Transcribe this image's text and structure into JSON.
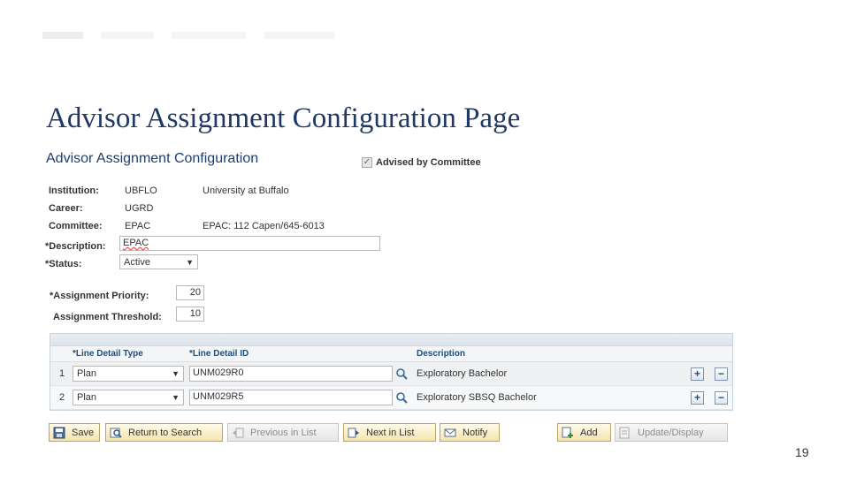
{
  "slide": {
    "title": "Advisor Assignment Configuration Page",
    "page_number": "19"
  },
  "panel": {
    "title": "Advisor Assignment Configuration",
    "advised_by_committee": {
      "label": "Advised by Committee",
      "checked": true
    },
    "fields": {
      "institution": {
        "label": "Institution:",
        "code": "UBFLO",
        "description": "University at Buffalo"
      },
      "career": {
        "label": "Career:",
        "code": "UGRD"
      },
      "committee": {
        "label": "Committee:",
        "code": "EPAC",
        "description": "EPAC: 112 Capen/645-6013"
      },
      "description": {
        "label": "*Description:",
        "value": "EPAC"
      },
      "status": {
        "label": "*Status:",
        "value": "Active"
      },
      "assignment_priority": {
        "label": "*Assignment Priority:",
        "value": "20"
      },
      "assignment_threshold": {
        "label": "Assignment Threshold:",
        "value": "10"
      }
    }
  },
  "grid": {
    "columns": [
      "*Line Detail Type",
      "*Line Detail ID",
      "Description"
    ],
    "rows": [
      {
        "num": "1",
        "type": "Plan",
        "id": "UNM029R0",
        "description": "Exploratory Bachelor"
      },
      {
        "num": "2",
        "type": "Plan",
        "id": "UNM029R5",
        "description": "Exploratory SBSQ Bachelor"
      }
    ],
    "add_row_symbol": "+",
    "delete_row_symbol": "−"
  },
  "toolbar": {
    "save": "Save",
    "return_to_search": "Return to Search",
    "previous_in_list": "Previous in List",
    "next_in_list": "Next in List",
    "notify": "Notify",
    "add": "Add",
    "update_display": "Update/Display"
  },
  "icons": {
    "checkbox": "checkbox-checked-icon",
    "lookup": "magnifier-icon",
    "save": "floppy-disk-icon",
    "return": "search-return-icon",
    "previous": "previous-list-icon",
    "next": "next-list-icon",
    "notify": "notify-envelope-icon",
    "add": "add-page-icon",
    "update": "update-display-icon"
  },
  "colors": {
    "title": "#1f3864",
    "panel_title": "#1c3f6e",
    "grid_header": "#1f4e79",
    "button_bg": "#f4e3ad",
    "button_border": "#b9a46b"
  }
}
